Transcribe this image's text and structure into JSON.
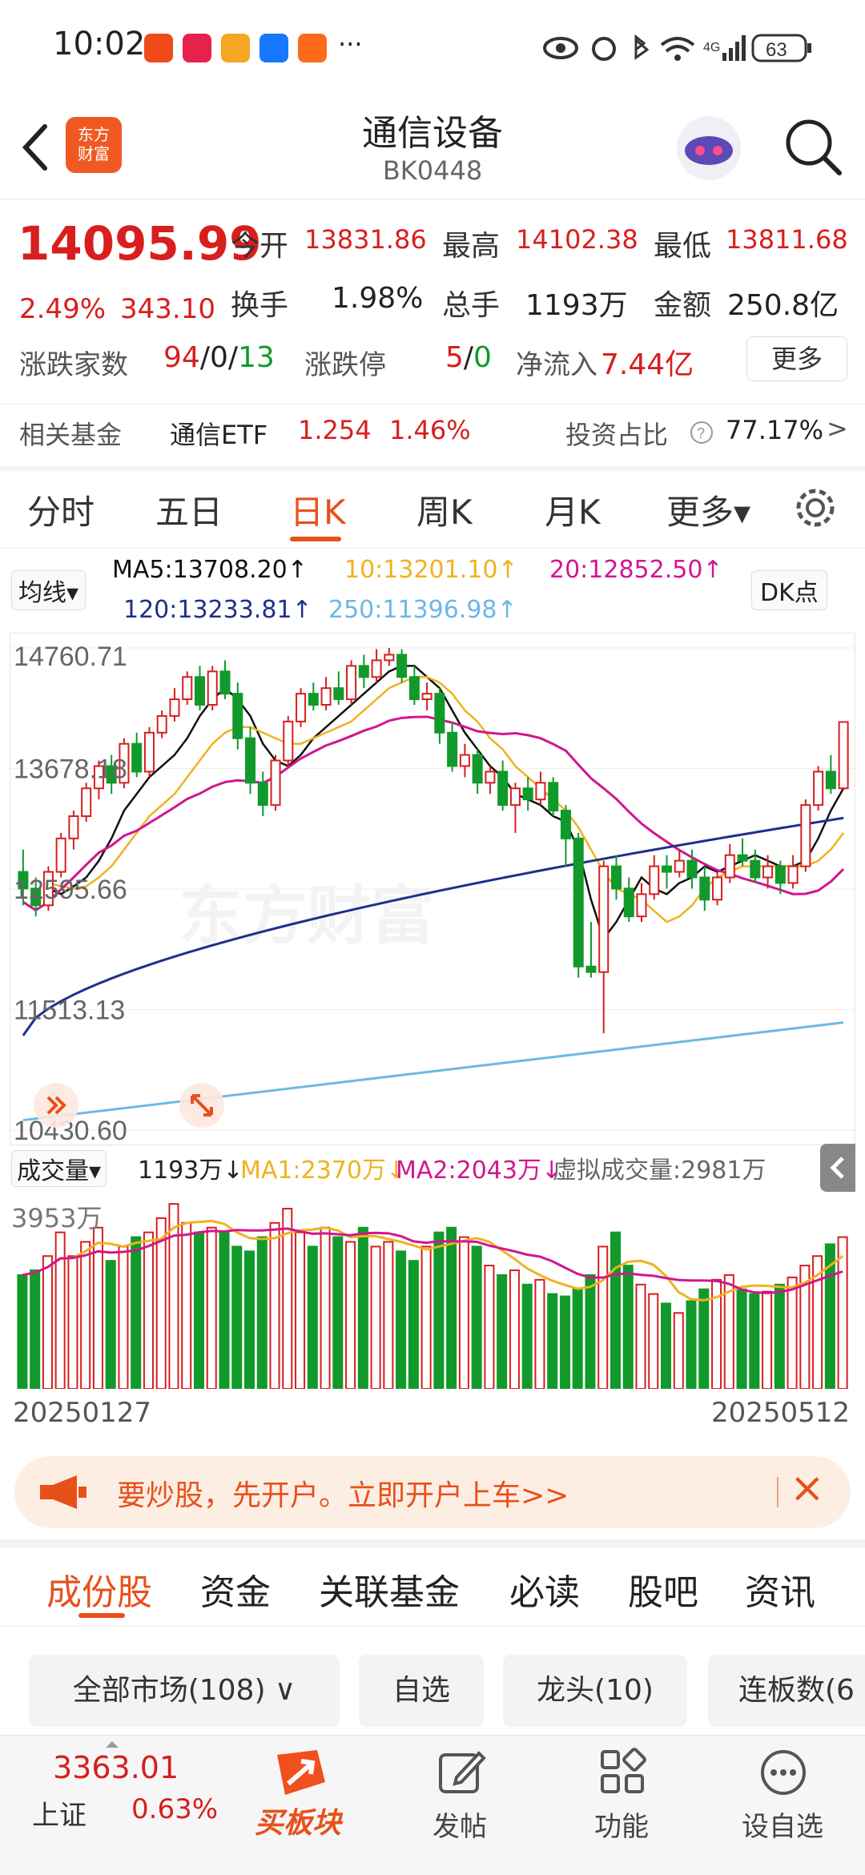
{
  "status_bar": {
    "time": "10:02",
    "more": "···",
    "network": "4G",
    "battery": "63"
  },
  "header": {
    "title": "通信设备",
    "code": "BK0448",
    "logo_text": "东方\n财富"
  },
  "quote": {
    "price": "14095.99",
    "pct": "2.49%",
    "change": "343.10",
    "open_label": "今开",
    "open": "13831.86",
    "high_label": "最高",
    "high": "14102.38",
    "low_label": "最低",
    "low": "13811.68",
    "turnover_label": "换手",
    "turnover": "1.98%",
    "volume_label": "总手",
    "volume": "1193万",
    "amount_label": "金额",
    "amount": "250.8亿",
    "breadth_label": "涨跌家数",
    "up": "94",
    "flat": "0",
    "down": "13",
    "limit_label": "涨跌停",
    "limit_up": "5",
    "limit_down": "0",
    "inflow_label": "净流入",
    "inflow": "7.44亿",
    "more_button": "更多"
  },
  "fund": {
    "label": "相关基金",
    "name": "通信ETF",
    "price": "1.254",
    "pct": "1.46%",
    "ratio_label": "投资占比",
    "ratio": "77.17%",
    "arrow": ">"
  },
  "period_tabs": [
    "分时",
    "五日",
    "日K",
    "周K",
    "月K",
    "更多▾"
  ],
  "active_tab": 2,
  "ma_legend": {
    "selector": "均线▾",
    "ma5": "MA5:13708.20↑",
    "ma10": "10:13201.10↑",
    "ma20": "20:12852.50↑",
    "ma120": "120:13233.81↑",
    "ma250": "250:11396.98↑",
    "dk_button": "DK点"
  },
  "colors": {
    "up": "#d81e1e",
    "down": "#119a2b",
    "ma5": "#111111",
    "ma10": "#f0b21e",
    "ma20": "#d0178f",
    "ma120": "#1f2f8c",
    "ma250": "#6cb8e6",
    "accent": "#e8501a"
  },
  "volume_legend": {
    "selector": "成交量▾",
    "value": "1193万↓",
    "ma1": "MA1:2370万↓",
    "ma2": "MA2:2043万↓",
    "virtual": "虚拟成交量:2981万"
  },
  "chart_data": {
    "type": "candlestick",
    "y_ticks": [
      "14760.71",
      "13678.18",
      "12595.66",
      "11513.13",
      "10430.60"
    ],
    "ylim": [
      10430.6,
      14760.71
    ],
    "volume_tick": "3953万",
    "x_start": "20250127",
    "x_end": "20250512",
    "candles": [
      [
        12750,
        12600,
        12950,
        12450
      ],
      [
        12600,
        12450,
        12700,
        12350
      ],
      [
        12450,
        12750,
        12800,
        12400
      ],
      [
        12750,
        13050,
        13100,
        12700
      ],
      [
        13050,
        13250,
        13300,
        12950
      ],
      [
        13250,
        13500,
        13550,
        13200
      ],
      [
        13500,
        13700,
        13750,
        13400
      ],
      [
        13700,
        13550,
        13800,
        13450
      ],
      [
        13550,
        13900,
        13950,
        13500
      ],
      [
        13900,
        13650,
        14000,
        13600
      ],
      [
        13650,
        14000,
        14050,
        13600
      ],
      [
        14000,
        14150,
        14200,
        13950
      ],
      [
        14150,
        14300,
        14400,
        14100
      ],
      [
        14300,
        14500,
        14550,
        14250
      ],
      [
        14500,
        14250,
        14600,
        14200
      ],
      [
        14250,
        14550,
        14600,
        14200
      ],
      [
        14550,
        14350,
        14650,
        14300
      ],
      [
        14350,
        13950,
        14450,
        13850
      ],
      [
        13950,
        13550,
        14050,
        13450
      ],
      [
        13550,
        13350,
        13650,
        13250
      ],
      [
        13350,
        13750,
        13800,
        13300
      ],
      [
        13750,
        14100,
        14150,
        13700
      ],
      [
        14100,
        14350,
        14400,
        14050
      ],
      [
        14350,
        14250,
        14450,
        14200
      ],
      [
        14250,
        14400,
        14500,
        14200
      ],
      [
        14400,
        14300,
        14550,
        14250
      ],
      [
        14300,
        14600,
        14650,
        14250
      ],
      [
        14600,
        14500,
        14700,
        14400
      ],
      [
        14500,
        14650,
        14750,
        14450
      ],
      [
        14650,
        14700,
        14760,
        14600
      ],
      [
        14700,
        14500,
        14750,
        14450
      ],
      [
        14500,
        14300,
        14600,
        14250
      ],
      [
        14300,
        14350,
        14450,
        14200
      ],
      [
        14350,
        14000,
        14400,
        13900
      ],
      [
        14000,
        13700,
        14100,
        13650
      ],
      [
        13700,
        13800,
        13900,
        13600
      ],
      [
        13800,
        13550,
        13850,
        13450
      ],
      [
        13550,
        13650,
        13700,
        13450
      ],
      [
        13650,
        13350,
        13750,
        13300
      ],
      [
        13350,
        13500,
        13550,
        13100
      ],
      [
        13500,
        13400,
        13600,
        13300
      ],
      [
        13400,
        13550,
        13650,
        13350
      ],
      [
        13550,
        13300,
        13600,
        13250
      ],
      [
        13300,
        13050,
        13350,
        12800
      ],
      [
        13050,
        11900,
        13100,
        11800
      ],
      [
        11900,
        11850,
        12300,
        11800
      ],
      [
        11850,
        12800,
        12850,
        11300
      ],
      [
        12800,
        12600,
        12900,
        12500
      ],
      [
        12600,
        12350,
        12700,
        12300
      ],
      [
        12350,
        12550,
        12650,
        12300
      ],
      [
        12550,
        12800,
        12900,
        12500
      ],
      [
        12800,
        12750,
        12900,
        12600
      ],
      [
        12750,
        12850,
        12950,
        12700
      ],
      [
        12850,
        12700,
        12950,
        12600
      ],
      [
        12700,
        12500,
        12800,
        12400
      ],
      [
        12500,
        12700,
        12750,
        12450
      ],
      [
        12700,
        12900,
        13000,
        12650
      ],
      [
        12900,
        12850,
        13050,
        12800
      ],
      [
        12850,
        12700,
        12950,
        12650
      ],
      [
        12700,
        12800,
        12900,
        12600
      ],
      [
        12800,
        12650,
        12850,
        12550
      ],
      [
        12650,
        12800,
        12900,
        12600
      ],
      [
        12800,
        13350,
        13400,
        12750
      ],
      [
        13350,
        13650,
        13700,
        13300
      ],
      [
        13650,
        13500,
        13800,
        13450
      ],
      [
        13500,
        14095.99,
        14102.38,
        13480
      ]
    ],
    "volumes": [
      2400,
      2500,
      2800,
      3300,
      2800,
      3100,
      3400,
      2700,
      3000,
      3200,
      3300,
      3600,
      3900,
      3500,
      3300,
      3400,
      3300,
      3000,
      2900,
      3200,
      3500,
      3800,
      3300,
      3000,
      3400,
      3200,
      3100,
      3400,
      3000,
      3100,
      2900,
      2700,
      3000,
      3300,
      3400,
      3200,
      3000,
      2600,
      2400,
      2500,
      2200,
      2300,
      2000,
      1950,
      2100,
      2400,
      3000,
      3300,
      2600,
      2200,
      2000,
      1800,
      1600,
      1850,
      2100,
      2300,
      2400,
      2100,
      2000,
      2050,
      2200,
      2350,
      2600,
      2800,
      3050,
      3200
    ],
    "ma_lines": {
      "MA5": [
        12600,
        12550,
        12620,
        12700,
        12850,
        13050,
        13300,
        13450,
        13600,
        13700,
        13800,
        13950,
        14150,
        14300,
        14400,
        14300,
        14150,
        13900,
        13750,
        13700,
        13800,
        13950,
        14050,
        14150,
        14250,
        14350,
        14450,
        14550,
        14600,
        14600,
        14500,
        14400,
        14200,
        14000,
        13850,
        13700,
        13600,
        13450,
        13400,
        13350,
        13250,
        13200,
        12950,
        12500,
        12150,
        12300,
        12500,
        12700,
        12600,
        12550,
        12650,
        12700,
        12800,
        12750,
        12800,
        12850,
        12900,
        12850,
        12800,
        12800,
        12850,
        13050,
        13300,
        13500
      ],
      "MA10": [
        12650,
        12620,
        12600,
        12620,
        12700,
        12800,
        12950,
        13100,
        13250,
        13350,
        13450,
        13600,
        13750,
        13900,
        14000,
        14050,
        14050,
        14000,
        13950,
        13900,
        13900,
        13950,
        14000,
        14050,
        14100,
        14200,
        14300,
        14400,
        14450,
        14500,
        14500,
        14450,
        14350,
        14200,
        14100,
        13950,
        13850,
        13700,
        13600,
        13500,
        13400,
        13300,
        13150,
        12950,
        12750,
        12600,
        12550,
        12500,
        12400,
        12300,
        12350,
        12450,
        12600,
        12700,
        12750,
        12800,
        12800,
        12800,
        12800,
        12800,
        12800,
        12850,
        12950,
        13100
      ]
    }
  },
  "banner": {
    "text": "要炒股，先开户。立即开户上车>>",
    "close": "×"
  },
  "bottom_tabs": [
    "成份股",
    "资金",
    "关联基金",
    "必读",
    "股吧",
    "资讯"
  ],
  "active_bottom_tab": 0,
  "filters": [
    "全部市场(108) ∨",
    "自选",
    "龙头(10)",
    "连板数(6"
  ],
  "footer": {
    "index_value": "3363.01",
    "index_name": "上证",
    "index_pct": "0.63%",
    "buy_label": "买板块",
    "post_label": "发帖",
    "func_label": "功能",
    "watch_label": "设自选"
  },
  "watermark": "东方财富"
}
